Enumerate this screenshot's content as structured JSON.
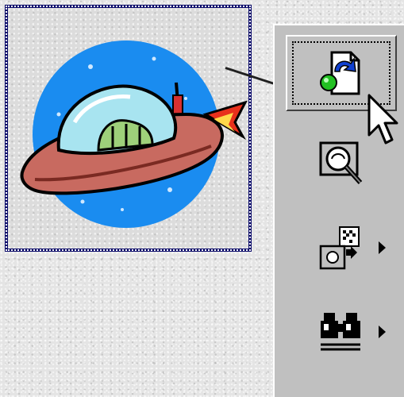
{
  "clip": {
    "picture_icon": "flying-saucer-clip-art"
  },
  "toolbar": {
    "buttons": [
      {
        "icon": "insert-clip-icon",
        "has_submenu": false,
        "state": "active"
      },
      {
        "icon": "preview-clip-magnifier-icon",
        "has_submenu": false,
        "state": "normal"
      },
      {
        "icon": "add-to-category-icon",
        "has_submenu": true,
        "state": "normal"
      },
      {
        "icon": "find-similar-binoculars-icon",
        "has_submenu": true,
        "state": "normal"
      }
    ]
  },
  "colors": {
    "frame_border": "#0a0a6a",
    "toolbar_face": "#c0c0c0",
    "saucer_body": "#c86a60",
    "sky_circle": "#1a8cf0"
  }
}
